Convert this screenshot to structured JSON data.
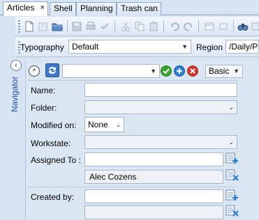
{
  "tabs": [
    {
      "label": "Articles",
      "close": "×"
    },
    {
      "label": "Shell"
    },
    {
      "label": "Planning"
    },
    {
      "label": "Trash can"
    }
  ],
  "filterbar": {
    "typography_label": "Typography",
    "typography_value": "Default",
    "region_label": "Region",
    "region_value": "/Daily/P"
  },
  "navigator": {
    "label": "Navigator",
    "toggle": "‹"
  },
  "panel": {
    "up_symbol": "^",
    "query_select_value": "",
    "mode_value": "Basic"
  },
  "form": {
    "name_label": "Name:",
    "name_value": "",
    "folder_label": "Folder:",
    "folder_value": "",
    "modified_label": "Modified on:",
    "modified_value": "None",
    "workstate_label": "Workstate:",
    "workstate_value": "",
    "assigned_label": "Assigned To :",
    "assigned_value": "",
    "assigned_user": "Alec Cozens",
    "created_label": "Created by:",
    "created_value": "",
    "created_user": ""
  },
  "colors": {
    "accent_blue": "#1f4fa8",
    "ok_green": "#3aa52b",
    "add_blue": "#2a7fd4",
    "remove_red": "#d63a2f"
  }
}
